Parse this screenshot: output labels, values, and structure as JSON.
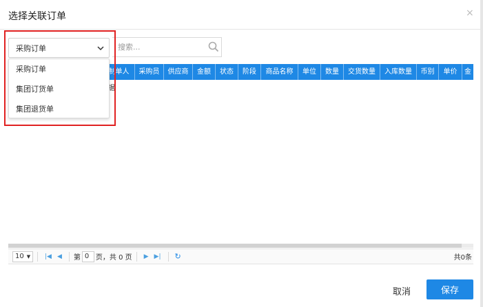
{
  "dialog": {
    "title": "选择关联订单",
    "close_glyph": "×"
  },
  "order_type_select": {
    "selected": "采购订单",
    "options": [
      "采购订单",
      "集团订货单",
      "集团退货单"
    ]
  },
  "search": {
    "placeholder": "搜索..."
  },
  "grid": {
    "columns": [
      "制单人",
      "采购员",
      "供应商",
      "金额",
      "状态",
      "阶段",
      "商品名称",
      "单位",
      "数量",
      "交货数量",
      "入库数量",
      "币别",
      "单价",
      "金"
    ],
    "empty_text_fragment": "据"
  },
  "pager": {
    "page_size": "10",
    "page_prefix": "第",
    "current_page": "0",
    "page_suffix": "页，共 0 页",
    "total": "共0条"
  },
  "footer": {
    "cancel_label": "取消",
    "save_label": "保存"
  },
  "colors": {
    "accent": "#1e88e5",
    "highlight": "#e02020"
  },
  "icons": [
    "close-icon",
    "chevron-down-icon",
    "search-icon",
    "first-page-icon",
    "prev-page-icon",
    "next-page-icon",
    "last-page-icon",
    "refresh-icon"
  ]
}
